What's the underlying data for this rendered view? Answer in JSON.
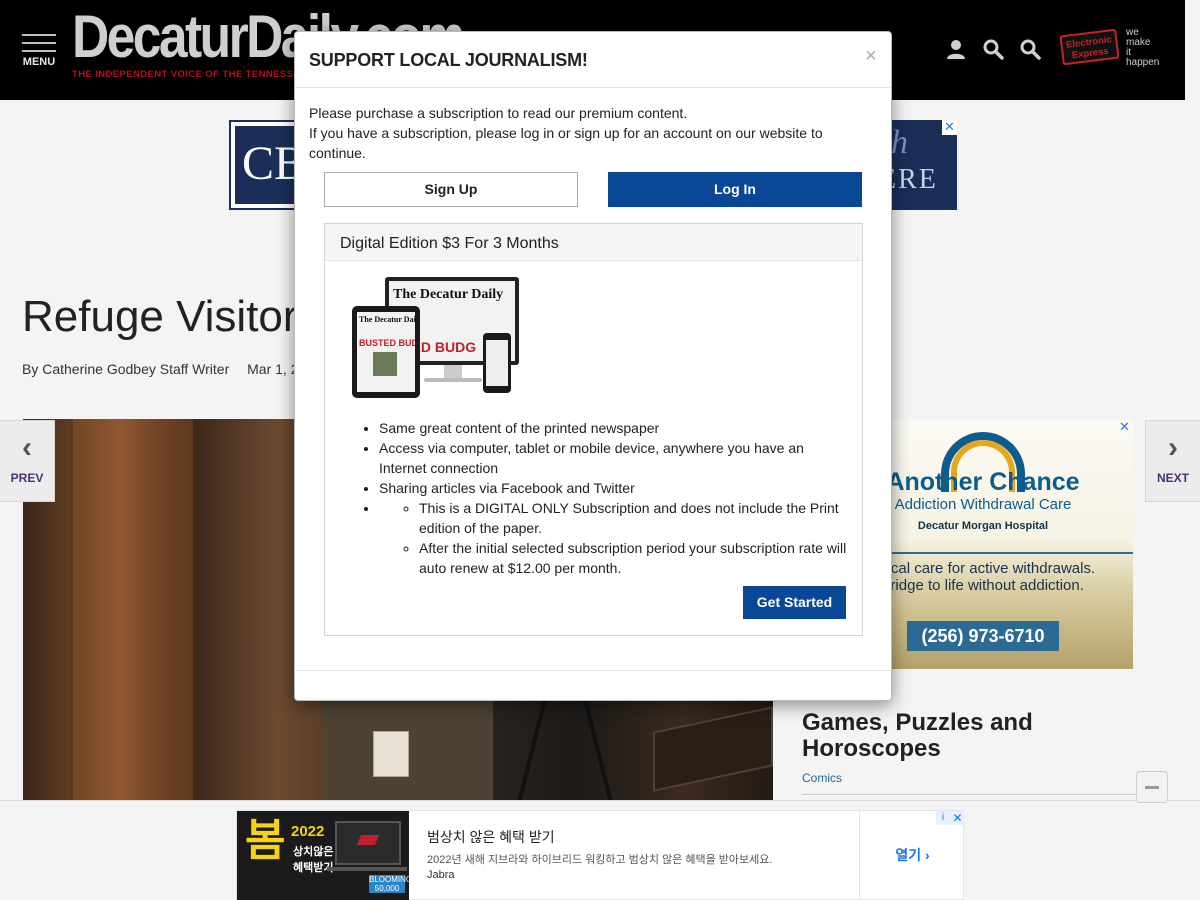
{
  "header": {
    "menu_label": "MENU",
    "logo_text": "DecaturDaily.com",
    "tagline": "THE INDEPENDENT VOICE OF THE TENNESSEE",
    "icons": [
      "user-icon",
      "search-icon",
      "search-icon"
    ],
    "sponsor": {
      "badge_text": "Electronic Express",
      "side_text": [
        "we",
        "make",
        "it",
        "happen"
      ]
    }
  },
  "banner_ad": {
    "text_1": "arch",
    "text_2": "ERE",
    "close": "✕"
  },
  "article": {
    "headline": "Refuge Visitor",
    "author": "By Catherine Godbey Staff Writer",
    "date": "Mar 1, 2",
    "prev_label": "PREV",
    "next_label": "NEXT"
  },
  "side_ad": {
    "title": "Another Chance",
    "subtitle": "Addiction Withdrawal Care",
    "hospital": "Decatur Morgan Hospital",
    "body_1": "edical care for active withdrawals.",
    "body_2": "bridge to life without addiction.",
    "phone": "(256) 973-6710",
    "close": "✕"
  },
  "sidebar": {
    "games_title": "Games, Puzzles and Horoscopes",
    "comics_link": "Comics"
  },
  "modal": {
    "title": "SUPPORT LOCAL JOURNALISM!",
    "close": "×",
    "message_1": "Please purchase a subscription to read our premium content.",
    "message_2": "If you have a subscription, please log in or sign up for an account on our website to continue.",
    "signup_label": "Sign Up",
    "login_label": "Log In",
    "offer": {
      "title": "Digital Edition $3 For 3 Months",
      "devices": {
        "monitor_title": "The Decatur Daily",
        "monitor_headline": "TED BUDG",
        "tablet_title": "The Decatur Daily",
        "tablet_headline": "BUSTED BUDGET?"
      },
      "bullets": [
        "Same great content of the printed newspaper",
        "Access via computer, tablet or mobile device, anywhere you have an Internet connection",
        "Sharing articles via Facebook and Twitter"
      ],
      "sub_bullets": [
        "This is a DIGITAL ONLY Subscription and does not include the Print edition of the paper.",
        "After the initial selected subscription period your subscription rate will auto renew at $12.00 per month."
      ],
      "cta": "Get Started"
    }
  },
  "bottom_ad": {
    "big_char": "봄",
    "year": "2022",
    "line_1": "상치않은",
    "line_2": "혜택받기",
    "headline": "범상치 않은 혜택 받기",
    "description": "2022년 새해 지브라와 하이브리드 워킹하고 범상치 않은 혜택을 받아보세요.",
    "brand": "Jabra",
    "cta": "열기",
    "badge": "BLOOMING 50,000",
    "info": "i",
    "close": "✕"
  },
  "colors": {
    "header_bg": "#000000",
    "accent_blue": "#0a4796",
    "logo_red": "#b5121b",
    "nav_purple": "#4a2f7a"
  }
}
